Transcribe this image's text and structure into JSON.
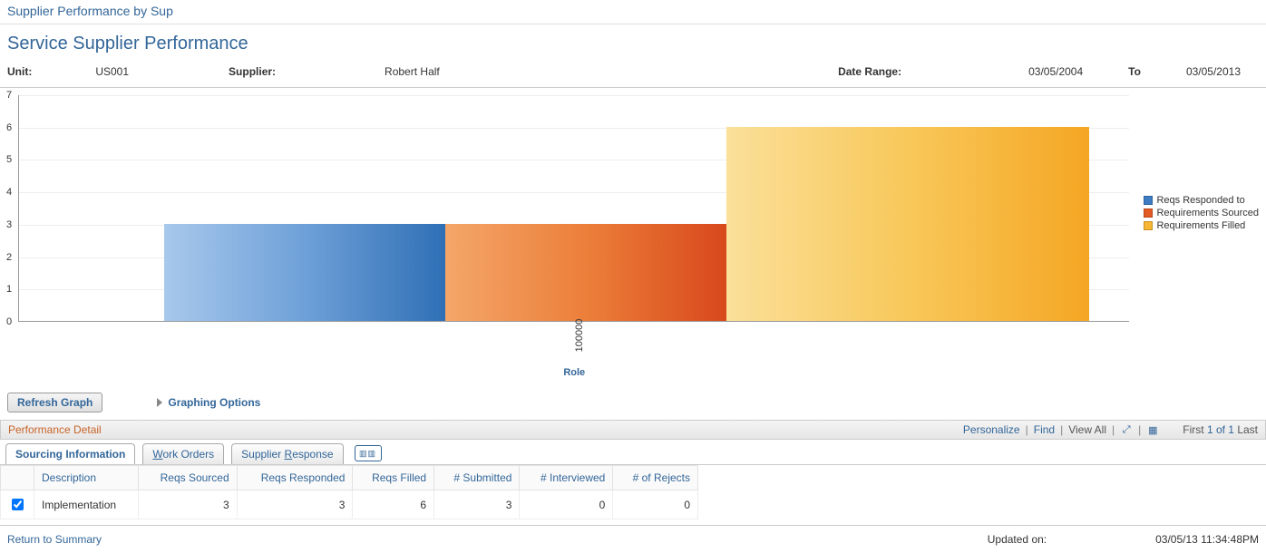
{
  "breadcrumb": "Supplier Performance by Sup",
  "page_title": "Service Supplier Performance",
  "filters": {
    "unit_label": "Unit:",
    "unit_value": "US001",
    "supplier_label": "Supplier:",
    "supplier_value": "Robert Half",
    "date_range_label": "Date Range:",
    "date_from": "03/05/2004",
    "to_label": "To",
    "date_to": "03/05/2013"
  },
  "legend": {
    "s1": "Reqs Responded to",
    "s2": "Requirements Sourced",
    "s3": "Requirements Filled"
  },
  "xaxis": {
    "tick0": "100000",
    "title": "Role"
  },
  "actions": {
    "refresh": "Refresh Graph",
    "graph_opts": "Graphing Options"
  },
  "grid": {
    "title": "Performance Detail",
    "personalize": "Personalize",
    "find": "Find",
    "view_all": "View All",
    "nav_first": "First",
    "nav_count": "1 of 1",
    "nav_last": "Last",
    "tabs": {
      "t1": "Sourcing Information",
      "t2_pre": "",
      "t2_ul": "W",
      "t2_post": "ork Orders",
      "t3_pre": "Supplier ",
      "t3_ul": "R",
      "t3_post": "esponse"
    },
    "cols": {
      "desc": "Description",
      "sourced": "Reqs Sourced",
      "responded": "Reqs Responded",
      "filled": "Reqs Filled",
      "submitted": "# Submitted",
      "interviewed": "# Interviewed",
      "rejects": "# of Rejects"
    },
    "row0": {
      "desc": "Implementation",
      "sourced": "3",
      "responded": "3",
      "filled": "6",
      "submitted": "3",
      "interviewed": "0",
      "rejects": "0"
    }
  },
  "footer": {
    "return": "Return to Summary",
    "updated_label": "Updated on:",
    "updated_value": "03/05/13 11:34:48PM"
  },
  "chart_data": {
    "type": "bar",
    "xlabel": "Role",
    "ylabel": "",
    "ylim": [
      0,
      7
    ],
    "categories": [
      "100000"
    ],
    "series": [
      {
        "name": "Reqs Responded to",
        "values": [
          3
        ]
      },
      {
        "name": "Requirements Sourced",
        "values": [
          3
        ]
      },
      {
        "name": "Requirements Filled",
        "values": [
          6
        ]
      }
    ]
  }
}
